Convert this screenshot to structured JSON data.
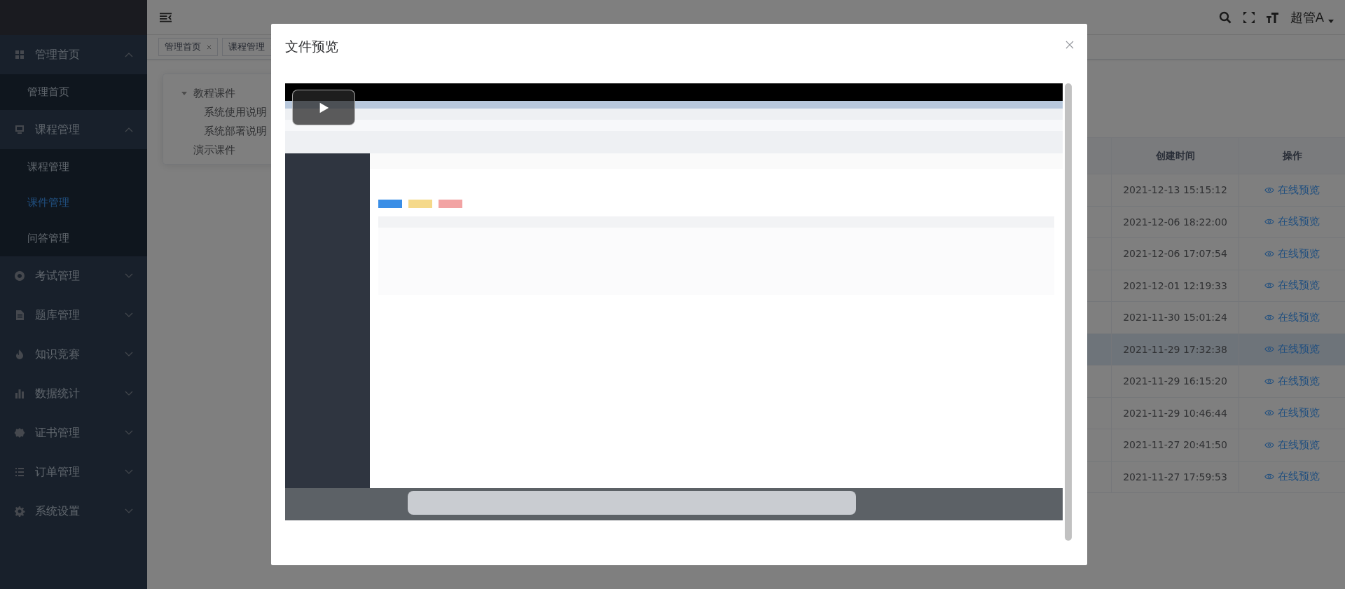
{
  "sidebar": {
    "items": [
      {
        "label": "管理首页",
        "expanded": true,
        "children": [
          {
            "label": "管理首页",
            "selected": false
          }
        ]
      },
      {
        "label": "课程管理",
        "expanded": true,
        "children": [
          {
            "label": "课程管理",
            "selected": false
          },
          {
            "label": "课件管理",
            "selected": true
          },
          {
            "label": "问答管理",
            "selected": false
          }
        ]
      },
      {
        "label": "考试管理",
        "expanded": false
      },
      {
        "label": "题库管理",
        "expanded": false
      },
      {
        "label": "知识竞赛",
        "expanded": false
      },
      {
        "label": "数据统计",
        "expanded": false
      },
      {
        "label": "证书管理",
        "expanded": false
      },
      {
        "label": "订单管理",
        "expanded": false
      },
      {
        "label": "系统设置",
        "expanded": false
      }
    ]
  },
  "header": {
    "user": "超管A"
  },
  "tags": [
    {
      "label": "管理首页"
    },
    {
      "label": "课程管理"
    }
  ],
  "tree": [
    {
      "label": "教程课件",
      "expanded": true,
      "children": [
        {
          "label": "系统使用说明"
        },
        {
          "label": "系统部署说明"
        }
      ]
    },
    {
      "label": "演示课件"
    }
  ],
  "table": {
    "columns": [
      "创建时间",
      "操作"
    ],
    "rows": [
      {
        "created": "2021-12-13 15:15:12",
        "action": "在线预览",
        "selected": false
      },
      {
        "created": "2021-12-06 18:22:00",
        "action": "在线预览",
        "selected": false
      },
      {
        "created": "2021-12-06 17:07:54",
        "action": "在线预览",
        "selected": false
      },
      {
        "created": "2021-12-01 12:19:33",
        "action": "在线预览",
        "selected": false
      },
      {
        "created": "2021-11-30 15:01:24",
        "action": "在线预览",
        "selected": false
      },
      {
        "created": "2021-11-29 17:32:38",
        "action": "在线预览",
        "selected": true
      },
      {
        "created": "2021-11-29 16:15:20",
        "action": "在线预览",
        "selected": false
      },
      {
        "created": "2021-11-29 10:46:44",
        "action": "在线预览",
        "selected": false
      },
      {
        "created": "2021-11-27 20:41:50",
        "action": "在线预览",
        "selected": false
      },
      {
        "created": "2021-11-27 17:59:53",
        "action": "在线预览",
        "selected": false
      }
    ]
  },
  "dialog": {
    "title": "文件预览"
  }
}
